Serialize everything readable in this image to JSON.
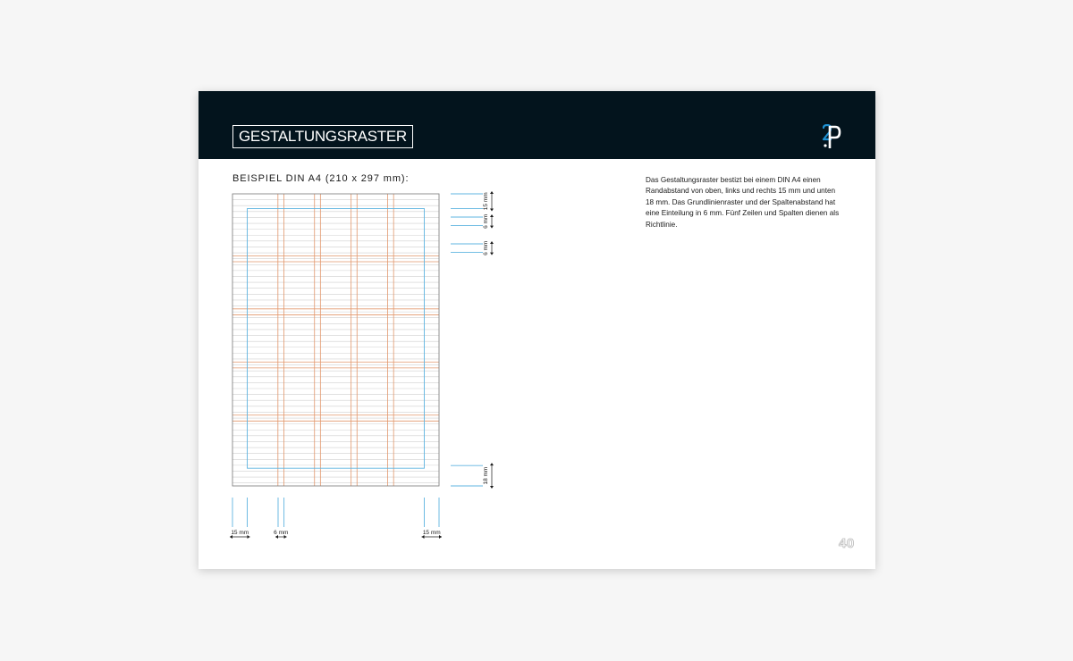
{
  "header": {
    "title": "GESTALTUNGSRASTER",
    "background_color": "#03141d",
    "logo_icon": "2p-logo-icon",
    "logo_colors": [
      "#ffffff",
      "#1e8fd0"
    ]
  },
  "section": {
    "title": "BEISPIEL DIN A4 (210 x 297 mm):"
  },
  "description": "Das Gestaltungsraster bestizt bei einem DIN A4 einen Randabstand von oben, links und rechts 15 mm und unten 18 mm. Das Grundlinienraster und der Spaltenabstand hat eine Einteilung in 6 mm. Fünf Zeilen und Spalten dienen als Richtlinie.",
  "grid_colors": {
    "margin": "#5fb4e0",
    "columns": "#e2976c",
    "baseline": "#cfcfcf",
    "frame": "#777777"
  },
  "dimensions": {
    "right": [
      {
        "label": "15 mm"
      },
      {
        "label": "6 mm"
      },
      {
        "label": "6 mm"
      },
      {
        "label": "18 mm"
      }
    ],
    "bottom": [
      {
        "label": "15 mm"
      },
      {
        "label": "6 mm"
      },
      {
        "label": "15 mm"
      }
    ]
  },
  "page_number": "40"
}
